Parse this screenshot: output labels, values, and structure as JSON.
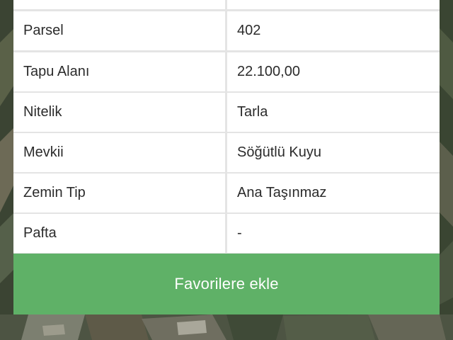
{
  "parcel_info": {
    "rows": [
      {
        "key": "",
        "value": ""
      },
      {
        "key": "Parsel",
        "value": "402"
      },
      {
        "key": "Tapu Alanı",
        "value": "22.100,00"
      },
      {
        "key": "Nitelik",
        "value": "Tarla"
      },
      {
        "key": "Mevkii",
        "value": "Söğütlü Kuyu"
      },
      {
        "key": "Zemin Tip",
        "value": "Ana Taşınmaz"
      },
      {
        "key": "Pafta",
        "value": "-"
      }
    ]
  },
  "actions": {
    "favorite_label": "Favorilere ekle"
  },
  "colors": {
    "button_green": "#5fb167",
    "row_bg": "#ffffff",
    "divider": "#e4e4e4",
    "text": "#2b2b2b"
  }
}
